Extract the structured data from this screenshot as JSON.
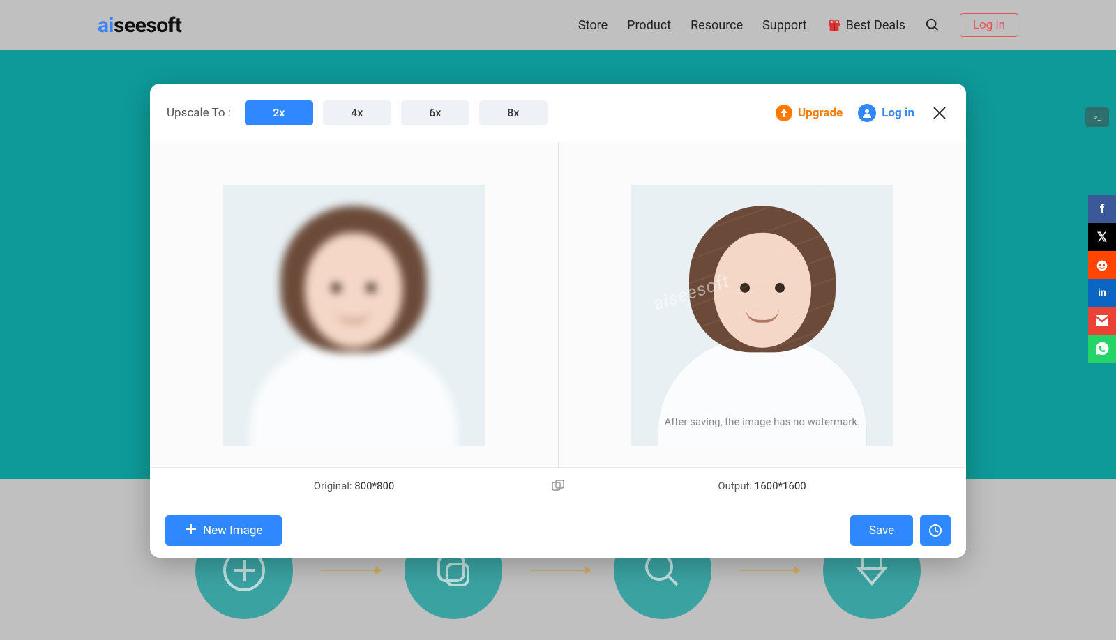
{
  "header": {
    "logo_prefix": "ai",
    "logo_rest": "seesoft",
    "nav": [
      "Store",
      "Product",
      "Resource",
      "Support"
    ],
    "best_deals": "Best Deals",
    "login": "Log in"
  },
  "modal": {
    "upscale_label": "Upscale To :",
    "scales": [
      "2x",
      "4x",
      "6x",
      "8x"
    ],
    "active_scale_index": 0,
    "upgrade": "Upgrade",
    "login": "Log in",
    "watermark_note": "After saving, the image has no watermark.",
    "original_label": "Original:",
    "original_value": "800*800",
    "output_label": "Output:",
    "output_value": "1600*1600",
    "new_image": "New Image",
    "save": "Save"
  },
  "social": [
    {
      "name": "facebook",
      "bg": "#3b5998",
      "glyph": "f"
    },
    {
      "name": "x-twitter",
      "bg": "#000000",
      "glyph": "𝕏"
    },
    {
      "name": "reddit",
      "bg": "#ff4500",
      "glyph": ""
    },
    {
      "name": "linkedin",
      "bg": "#0a66c2",
      "glyph": "in"
    },
    {
      "name": "gmail",
      "bg": "#ea4335",
      "glyph": "M"
    },
    {
      "name": "whatsapp",
      "bg": "#25d366",
      "glyph": ""
    }
  ]
}
